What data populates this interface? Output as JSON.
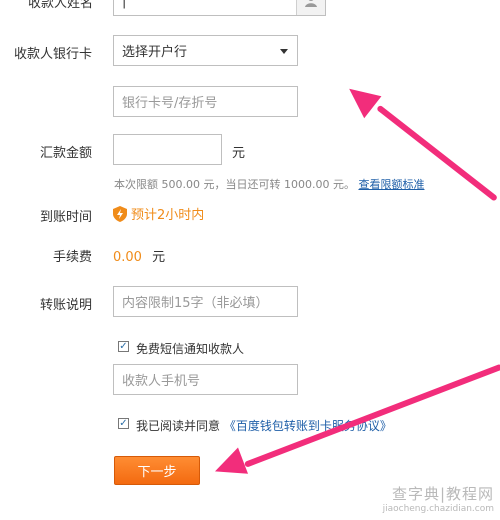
{
  "form": {
    "payee_name_label": "收款人姓名",
    "payee_name_value": "|",
    "bank_card_label": "收款人银行卡",
    "bank_select_value": "选择开户行",
    "card_number_placeholder": "银行卡号/存折号",
    "amount_label": "汇款金额",
    "amount_unit": "元",
    "limit_hint": "本次限额 500.00 元，当日还可转 1000.00 元。",
    "limit_link": "查看限额标准",
    "arrival_label": "到账时间",
    "arrival_value": "预计2小时内",
    "fee_label": "手续费",
    "fee_value": "0.00",
    "fee_unit": "元",
    "note_label": "转账说明",
    "note_placeholder": "内容限制15字（非必填）",
    "sms_checkbox_label": "免费短信通知收款人",
    "sms_checked": true,
    "phone_placeholder": "收款人手机号",
    "agree_label": "我已阅读并同意",
    "agree_link": "《百度钱包转账到卡服务协议》",
    "agree_checked": true,
    "next_button": "下一步"
  },
  "colors": {
    "accent_orange": "#f36a10",
    "fee_orange": "#f08c1a",
    "link_blue": "#1f5fa8",
    "arrow_pink": "#f22d7b"
  },
  "watermark": {
    "site_cn": "查字典|教程网",
    "site_url": "jiaocheng.chazidian.com"
  }
}
